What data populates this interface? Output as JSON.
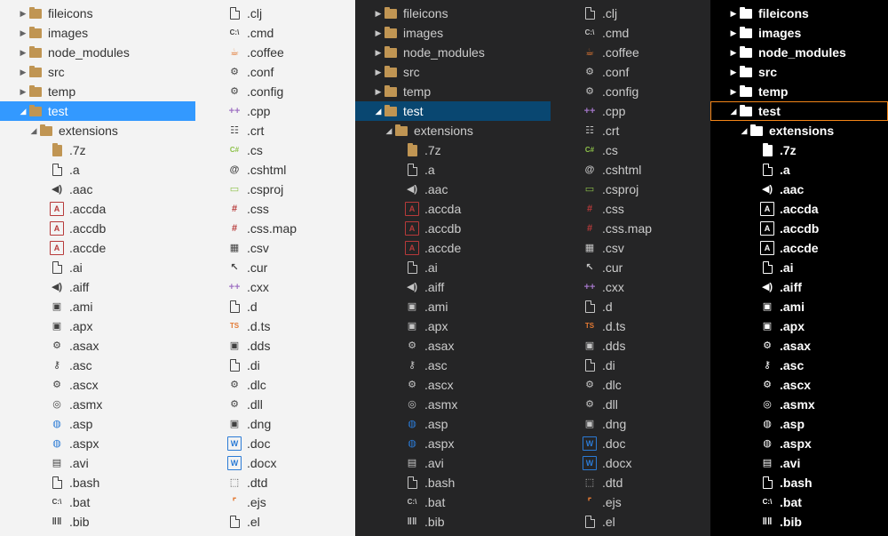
{
  "colors": {
    "light_bg": "#f3f3f3",
    "dark_bg": "#252526",
    "hc_bg": "#000000",
    "light_selection": "#3399ff",
    "dark_selection": "#094771",
    "hc_outline": "#f38518",
    "folder_tan": "#c09553",
    "accent_red": "#b73a3a",
    "accent_blue": "#2b7bd6",
    "accent_orange": "#e37933",
    "accent_purple": "#a074c4",
    "accent_green": "#8dc149"
  },
  "left_column": [
    {
      "label": "fileicons",
      "kind": "folder",
      "level": 0,
      "twisty": "right"
    },
    {
      "label": "images",
      "kind": "folder",
      "level": 0,
      "twisty": "right"
    },
    {
      "label": "node_modules",
      "kind": "folder",
      "level": 0,
      "twisty": "right"
    },
    {
      "label": "src",
      "kind": "folder",
      "level": 0,
      "twisty": "right"
    },
    {
      "label": "temp",
      "kind": "folder",
      "level": 0,
      "twisty": "right"
    },
    {
      "label": "test",
      "kind": "folder-open",
      "level": 0,
      "twisty": "down",
      "selected": true
    },
    {
      "label": "extensions",
      "kind": "folder-open",
      "level": 1,
      "twisty": "down"
    },
    {
      "label": ".7z",
      "kind": "archive-icon",
      "level": 2
    },
    {
      "label": ".a",
      "kind": "file-icon",
      "level": 2
    },
    {
      "label": ".aac",
      "kind": "audio-icon",
      "level": 2
    },
    {
      "label": ".accda",
      "kind": "access-icon",
      "level": 2
    },
    {
      "label": ".accdb",
      "kind": "access-icon",
      "level": 2
    },
    {
      "label": ".accde",
      "kind": "access-icon",
      "level": 2
    },
    {
      "label": ".ai",
      "kind": "file-icon",
      "level": 2
    },
    {
      "label": ".aiff",
      "kind": "audio-icon",
      "level": 2
    },
    {
      "label": ".ami",
      "kind": "image-icon",
      "level": 2
    },
    {
      "label": ".apx",
      "kind": "image-icon",
      "level": 2
    },
    {
      "label": ".asax",
      "kind": "gear-file-icon",
      "level": 2
    },
    {
      "label": ".asc",
      "kind": "key-icon",
      "level": 2
    },
    {
      "label": ".ascx",
      "kind": "gear-file-icon",
      "level": 2
    },
    {
      "label": ".asmx",
      "kind": "web-service-icon",
      "level": 2
    },
    {
      "label": ".asp",
      "kind": "globe-file-icon",
      "level": 2
    },
    {
      "label": ".aspx",
      "kind": "globe-file-icon",
      "level": 2
    },
    {
      "label": ".avi",
      "kind": "video-icon",
      "level": 2
    },
    {
      "label": ".bash",
      "kind": "file-icon",
      "level": 2
    },
    {
      "label": ".bat",
      "kind": "terminal-icon",
      "level": 2
    },
    {
      "label": ".bib",
      "kind": "books-icon",
      "level": 2
    }
  ],
  "right_column": [
    {
      "label": ".clj",
      "kind": "file-icon"
    },
    {
      "label": ".cmd",
      "kind": "terminal-icon"
    },
    {
      "label": ".coffee",
      "kind": "coffee-icon"
    },
    {
      "label": ".conf",
      "kind": "config-icon"
    },
    {
      "label": ".config",
      "kind": "config-icon"
    },
    {
      "label": ".cpp",
      "kind": "cpp-icon"
    },
    {
      "label": ".crt",
      "kind": "certificate-icon"
    },
    {
      "label": ".cs",
      "kind": "csharp-icon"
    },
    {
      "label": ".cshtml",
      "kind": "razor-icon"
    },
    {
      "label": ".csproj",
      "kind": "project-icon"
    },
    {
      "label": ".css",
      "kind": "css-icon"
    },
    {
      "label": ".css.map",
      "kind": "css-icon"
    },
    {
      "label": ".csv",
      "kind": "table-icon"
    },
    {
      "label": ".cur",
      "kind": "cursor-icon"
    },
    {
      "label": ".cxx",
      "kind": "cpp-icon"
    },
    {
      "label": ".d",
      "kind": "file-icon"
    },
    {
      "label": ".d.ts",
      "kind": "typescript-icon"
    },
    {
      "label": ".dds",
      "kind": "image-icon"
    },
    {
      "label": ".di",
      "kind": "file-icon"
    },
    {
      "label": ".dlc",
      "kind": "gear-file-icon"
    },
    {
      "label": ".dll",
      "kind": "gear-file-icon"
    },
    {
      "label": ".dng",
      "kind": "image-icon"
    },
    {
      "label": ".doc",
      "kind": "word-icon"
    },
    {
      "label": ".docx",
      "kind": "word-icon"
    },
    {
      "label": ".dtd",
      "kind": "dtd-icon"
    },
    {
      "label": ".ejs",
      "kind": "template-icon"
    },
    {
      "label": ".el",
      "kind": "file-icon"
    }
  ]
}
